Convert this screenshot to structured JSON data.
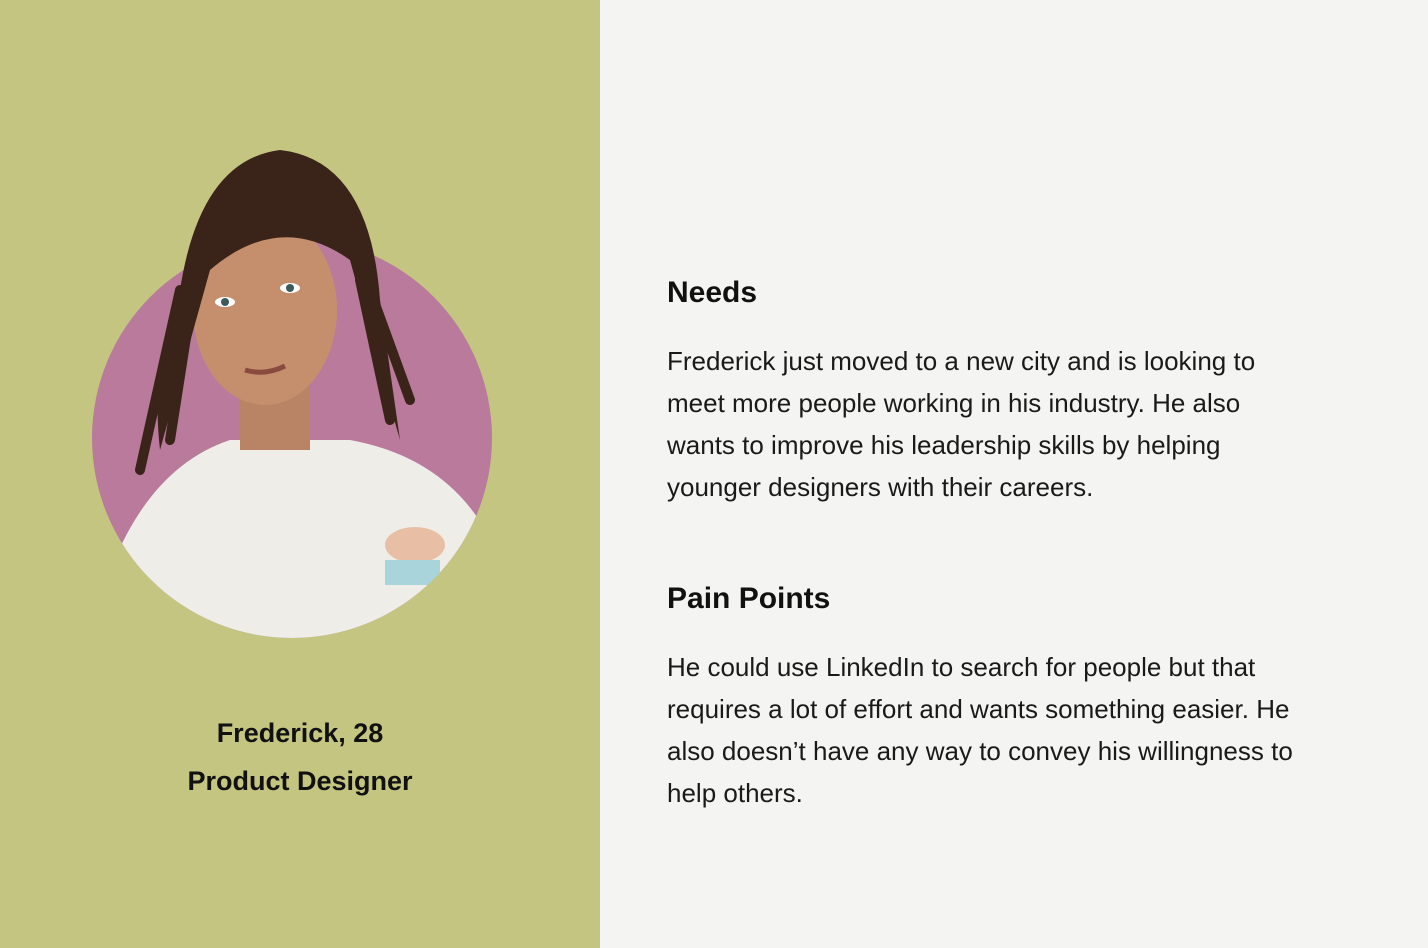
{
  "persona": {
    "name_age": "Frederick, 28",
    "role": "Product Designer"
  },
  "needs": {
    "heading": "Needs",
    "body": "Frederick just moved to a new city and is looking to meet more people working in his industry. He also wants to improve his leadership skills by helping younger designers with their careers."
  },
  "pain_points": {
    "heading": "Pain Points",
    "body": "He could use LinkedIn to search for people but that requires a lot of effort and wants something easier. He also doesn’t have any way to convey his willingness to help others."
  },
  "colors": {
    "left_bg": "#c3c581",
    "right_bg": "#f4f4f2",
    "circle": "#b97a9c"
  }
}
